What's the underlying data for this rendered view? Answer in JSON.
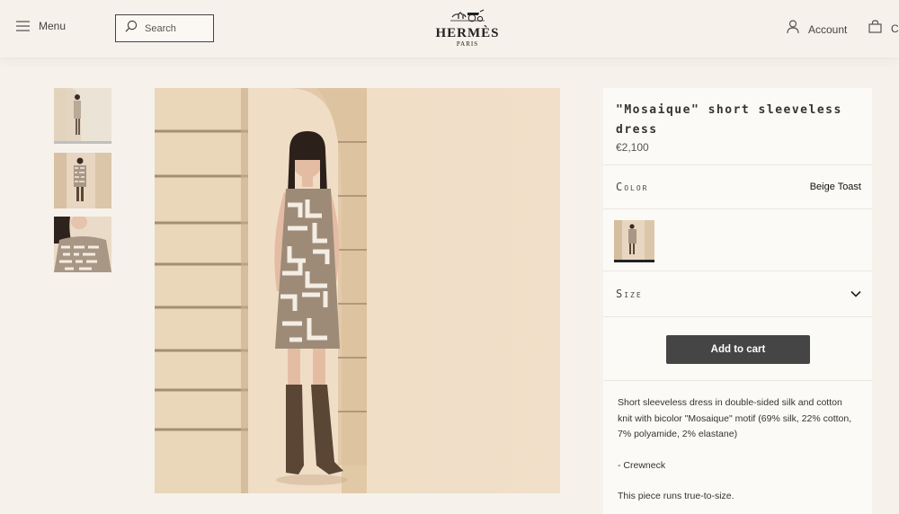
{
  "header": {
    "menu_label": "Menu",
    "search_placeholder": "Search",
    "logo_name": "HERMÈS",
    "logo_sub": "PARIS",
    "account_label": "Account",
    "cart_label": "C"
  },
  "product": {
    "title": "\"Mosaique\" short sleeveless dress",
    "price": "€2,100",
    "color_label": "Color",
    "color_value": "Beige Toast",
    "size_label": "Size",
    "add_to_cart": "Add to cart",
    "description": "Short sleeveless dress in double-sided silk and cotton knit with bicolor \"Mosaique\" motif (69% silk, 22% cotton, 7% polyamide, 2% elastane)",
    "feature": "- Crewneck",
    "fit_note": "This piece runs true-to-size."
  },
  "gallery": {
    "thumbnails": [
      "full-length back view",
      "full-length front view",
      "close-up detail"
    ],
    "selected_index": 0
  },
  "icons": {
    "menu": "hamburger-icon",
    "search": "search-icon",
    "account": "user-icon",
    "cart": "bag-icon",
    "size_toggle": "chevron-down-icon"
  },
  "colors": {
    "background": "#f6f1eb",
    "panel": "#fcfaf7",
    "button": "#454545",
    "button_text": "#ffffff"
  }
}
